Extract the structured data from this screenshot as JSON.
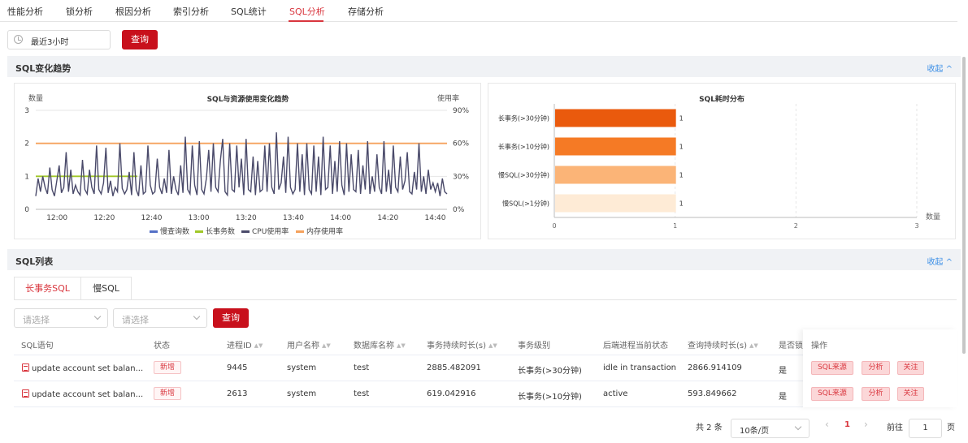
{
  "tabs": [
    {
      "label": "性能分析",
      "active": false
    },
    {
      "label": "锁分析",
      "active": false
    },
    {
      "label": "根因分析",
      "active": false
    },
    {
      "label": "索引分析",
      "active": false
    },
    {
      "label": "SQL统计",
      "active": false
    },
    {
      "label": "SQL分析",
      "active": true
    },
    {
      "label": "存储分析",
      "active": false
    }
  ],
  "time_picker": {
    "value": "最近3小时",
    "icon": "clock-icon"
  },
  "query_label": "查询",
  "trend_section": {
    "title": "SQL变化趋势",
    "collapse": "收起 ^"
  },
  "list_section": {
    "title": "SQL列表",
    "collapse": "收起 ^"
  },
  "colors": {
    "accent": "#c8101c",
    "slow_query": "#5470c6",
    "long_tx": "#a0c828",
    "cpu": "#4a4a6a",
    "mem": "#f5a25d",
    "bar_long30": "#ea5a0d",
    "bar_long10": "#f57a25",
    "bar_slow30": "#fbb477",
    "bar_slow1": "#feebd6"
  },
  "chart_data": [
    {
      "type": "line",
      "title": "SQL与资源使用变化趋势",
      "ylabel": "数量",
      "y2label": "使用率",
      "ylim": [
        0,
        3
      ],
      "y2lim": [
        0,
        90
      ],
      "yticks": [
        "0",
        "1",
        "2",
        "3"
      ],
      "y2ticks": [
        "0%",
        "30%",
        "60%",
        "90%"
      ],
      "xticks": [
        "12:00",
        "12:20",
        "12:40",
        "13:00",
        "13:20",
        "13:40",
        "14:00",
        "14:20",
        "14:40"
      ],
      "x_range_minutes": [
        11.0,
        185.0
      ],
      "legend": [
        "慢查询数",
        "长事务数",
        "CPU使用率",
        "内存使用率"
      ],
      "legend_position": "bottom",
      "series": [
        {
          "name": "长事务数",
          "axis": "left",
          "values": [
            1,
            1,
            1,
            1,
            1,
            1,
            1,
            1,
            1,
            1,
            1,
            1,
            1,
            1,
            1,
            1,
            1,
            1,
            1,
            1,
            1,
            1,
            1,
            1,
            1,
            1,
            1,
            1,
            1,
            1,
            1,
            1,
            1,
            1,
            1,
            1,
            1,
            1,
            1,
            1,
            1,
            1,
            1
          ]
        },
        {
          "name": "内存使用率",
          "axis": "right",
          "values": [
            60,
            60,
            60,
            60,
            60,
            60,
            60,
            60,
            60,
            60,
            60,
            60,
            60,
            60,
            60,
            60,
            60,
            60,
            60,
            60,
            60,
            60,
            60,
            60,
            60,
            60,
            60,
            60,
            60,
            60,
            60,
            60,
            60,
            60,
            60,
            60,
            60,
            60,
            60,
            60,
            60,
            60,
            60,
            60,
            60,
            60,
            60,
            60,
            60,
            60,
            60,
            60,
            60,
            60,
            60,
            60,
            60,
            60,
            60,
            60,
            60,
            60,
            60,
            60,
            60,
            60,
            60,
            60,
            60,
            60,
            60,
            60,
            60,
            60,
            60,
            60,
            60,
            60,
            60,
            60,
            60,
            60,
            60,
            60,
            60,
            60,
            60,
            60
          ]
        },
        {
          "name": "CPU使用率",
          "axis": "right",
          "values": [
            12,
            28,
            16,
            30,
            20,
            14,
            38,
            18,
            12,
            26,
            40,
            15,
            20,
            52,
            16,
            36,
            14,
            22,
            16,
            13,
            45,
            18,
            14,
            36,
            20,
            14,
            58,
            18,
            14,
            24,
            56,
            15,
            26,
            12,
            20,
            16,
            60,
            19,
            14,
            18,
            34,
            13,
            52,
            18,
            12,
            40,
            14,
            16,
            58,
            22,
            14,
            16,
            46,
            20,
            14,
            28,
            15,
            54,
            14,
            30,
            18,
            13,
            40,
            15,
            66,
            18,
            14,
            58,
            22,
            13,
            62,
            18,
            14,
            28,
            54,
            16,
            60,
            20,
            16,
            44,
            64,
            16,
            13,
            60,
            18,
            16,
            58,
            20,
            46,
            13,
            64,
            18,
            16,
            48,
            13,
            44,
            16,
            18,
            58,
            16,
            60,
            20,
            14,
            70,
            18,
            24,
            48,
            15,
            66,
            20,
            14,
            18,
            60,
            16,
            50,
            13,
            60,
            18,
            14,
            58,
            16,
            48,
            13,
            66,
            18,
            20,
            58,
            14,
            44,
            16,
            62,
            22,
            13,
            60,
            16,
            50,
            18,
            16,
            54,
            14,
            40,
            18,
            62,
            14,
            30,
            16,
            50,
            20,
            14,
            62,
            16,
            36,
            14,
            58,
            20,
            16,
            48,
            18,
            26,
            52,
            16,
            14,
            34,
            18,
            60,
            16,
            30,
            14,
            36,
            18,
            24,
            16,
            24,
            12,
            28,
            16,
            14
          ]
        }
      ]
    },
    {
      "type": "bar",
      "orientation": "horizontal",
      "title": "SQL耗时分布",
      "categories": [
        "长事务(>30分钟)",
        "长事务(>10分钟)",
        "慢SQL(>30分钟)",
        "慢SQL(>1分钟)"
      ],
      "values": [
        1,
        1,
        1,
        1
      ],
      "xlabel": "数量",
      "xlim": [
        0,
        3
      ],
      "xticks": [
        "0",
        "1",
        "2",
        "3"
      ]
    }
  ],
  "subtabs": [
    {
      "label": "长事务SQL",
      "active": true
    },
    {
      "label": "慢SQL",
      "active": false
    }
  ],
  "filters": [
    {
      "placeholder": "请选择"
    },
    {
      "placeholder": "请选择"
    }
  ],
  "table": {
    "columns": [
      "SQL语句",
      "状态",
      "进程ID",
      "用户名称",
      "数据库名称",
      "事务持续时长(s)",
      "事务级别",
      "后端进程当前状态",
      "查询持续时长(s)",
      "是否锁",
      "操作"
    ],
    "rows": [
      {
        "sql": "update account set balan...",
        "status": "新增",
        "pid": "9445",
        "user": "system",
        "db": "test",
        "tx_duration": "2885.482091",
        "tx_level": "长事务(>30分钟)",
        "backend_state": "idle in transaction",
        "query_duration": "2866.914109",
        "locked": "是"
      },
      {
        "sql": "update account set balan...",
        "status": "新增",
        "pid": "2613",
        "user": "system",
        "db": "test",
        "tx_duration": "619.042916",
        "tx_level": "长事务(>10分钟)",
        "backend_state": "active",
        "query_duration": "593.849662",
        "locked": "是"
      }
    ],
    "actions": [
      "SQL来源",
      "分析",
      "关注"
    ]
  },
  "pagination": {
    "total": "共 2 条",
    "page_size": "10条/页",
    "prev": "‹",
    "current": "1",
    "next": "›",
    "goto_label": "前往",
    "goto_value": "1",
    "page_unit": "页"
  }
}
